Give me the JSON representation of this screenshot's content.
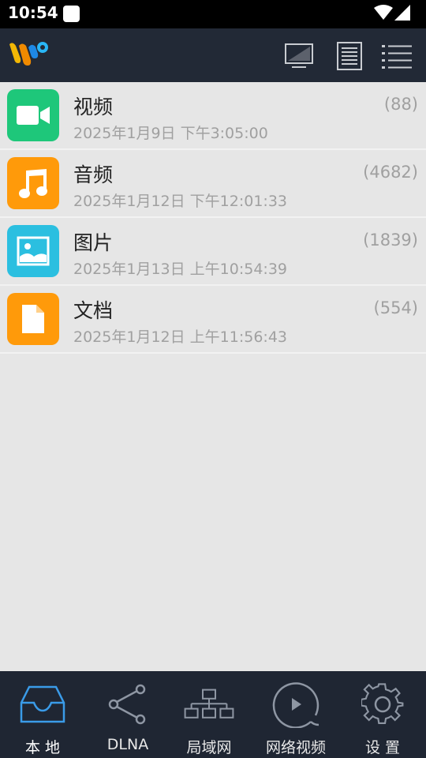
{
  "status_bar": {
    "time": "10:54"
  },
  "app_bar": {
    "logo": "app-logo",
    "actions": [
      {
        "name": "tv-icon"
      },
      {
        "name": "document-list-icon"
      },
      {
        "name": "menu-list-icon"
      }
    ]
  },
  "categories": [
    {
      "title": "视频",
      "date": "2025年1月9日 下午3:05:00",
      "count": "(88)",
      "icon": "video-camera-icon",
      "color": "#1ec77a"
    },
    {
      "title": "音频",
      "date": "2025年1月12日 下午12:01:33",
      "count": "(4682)",
      "icon": "music-note-icon",
      "color": "#ff9a0a"
    },
    {
      "title": "图片",
      "date": "2025年1月13日 上午10:54:39",
      "count": "(1839)",
      "icon": "image-icon",
      "color": "#2bbfe0"
    },
    {
      "title": "文档",
      "date": "2025年1月12日 上午11:56:43",
      "count": "(554)",
      "icon": "document-icon",
      "color": "#ff9a0a"
    }
  ],
  "bottom_nav": {
    "active_color": "#3a9be8",
    "tabs": [
      {
        "label": "本 地",
        "icon": "inbox-icon",
        "active": true
      },
      {
        "label": "DLNA",
        "icon": "share-icon",
        "active": false
      },
      {
        "label": "局域网",
        "icon": "network-icon",
        "active": false
      },
      {
        "label": "网络视频",
        "icon": "play-circle-icon",
        "active": false
      },
      {
        "label": "设 置",
        "icon": "gear-icon",
        "active": false
      }
    ]
  }
}
